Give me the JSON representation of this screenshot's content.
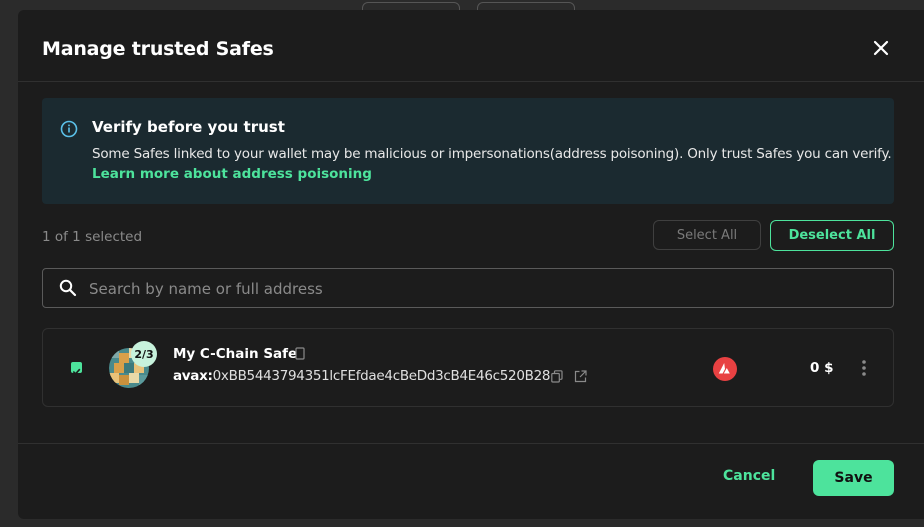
{
  "modal": {
    "title": "Manage trusted Safes"
  },
  "info": {
    "title": "Verify before you trust",
    "text": "Some Safes linked to your wallet may be malicious or impersonations(address poisoning). Only trust Safes you can verify.",
    "link": "Learn more about address poisoning",
    "icon": "info-icon"
  },
  "selection": {
    "count_text": "1 of 1 selected",
    "select_all": "Select All",
    "deselect_all": "Deselect All"
  },
  "search": {
    "placeholder": "Search by name or full address",
    "value": ""
  },
  "safes": [
    {
      "name": "My C-Chain Safe",
      "prefix": "avax:",
      "address": "0xBB5443794351lcFEfdae4cBeDd3cB4E46c520B28",
      "threshold": "2/3",
      "balance": "0 $",
      "chain_icon": "avalanche-icon",
      "selected": true
    }
  ],
  "footer": {
    "cancel": "Cancel",
    "save": "Save"
  },
  "colors": {
    "accent": "#4de39c",
    "modal_bg": "#1c1c1c",
    "info_bg": "#1b2a30",
    "chain_red": "#e84142"
  }
}
